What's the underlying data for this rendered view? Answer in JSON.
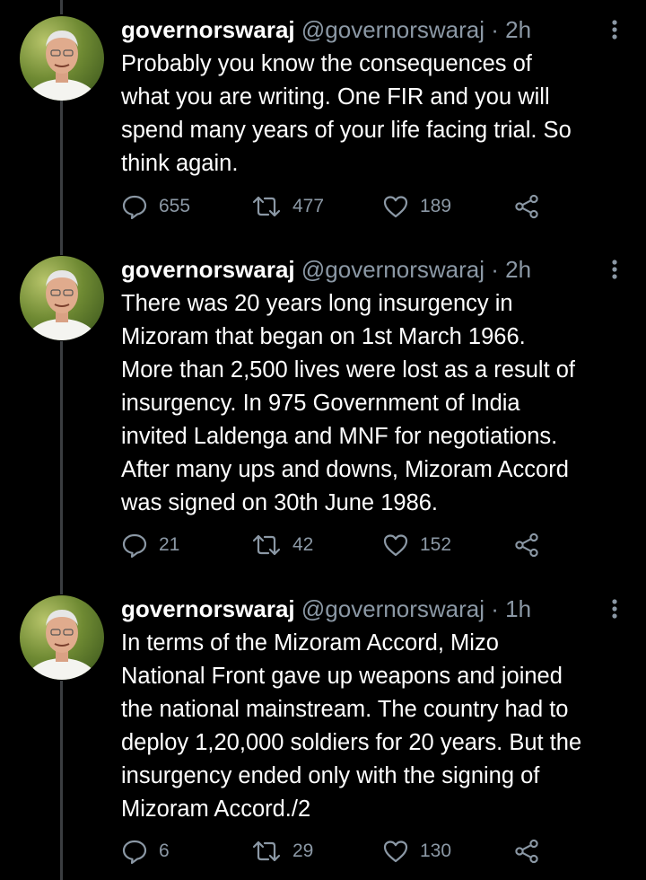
{
  "tweets": [
    {
      "name": "governorswaraj",
      "handle": "@governorswaraj",
      "separator": "·",
      "time": "2h",
      "text": "Probably  you know the consequences of\nwhat you are writing. One FIR and you will\nspend many years of your life facing trial. So\nthink again.",
      "replies": "655",
      "retweets": "477",
      "likes": "189"
    },
    {
      "name": "governorswaraj",
      "handle": "@governorswaraj",
      "separator": "·",
      "time": "2h",
      "text": "There was 20 years long insurgency in\nMizoram that began on 1st March 1966.\nMore than 2,500 lives were lost as a result of\ninsurgency. In 975 Government of India\ninvited Laldenga and MNF for negotiations.\nAfter many ups and downs, Mizoram Accord\nwas signed on 30th June 1986.",
      "replies": "21",
      "retweets": "42",
      "likes": "152"
    },
    {
      "name": "governorswaraj",
      "handle": "@governorswaraj",
      "separator": "·",
      "time": "1h",
      "text": "In terms of the Mizoram Accord, Mizo\nNational Front gave up weapons and joined\nthe national mainstream. The country had to\ndeploy 1,20,000 soldiers for 20 years. But the\ninsurgency ended only with the signing of\nMizoram Accord./2",
      "replies": "6",
      "retweets": "29",
      "likes": "130"
    }
  ],
  "icons": {
    "reply": "reply-icon",
    "retweet": "retweet-icon",
    "like": "heart-icon",
    "share": "share-icon",
    "more": "more-vertical-icon"
  },
  "colors": {
    "background": "#000000",
    "text": "#ffffff",
    "muted": "#8b98a5",
    "thread_line": "#3a3d40"
  }
}
